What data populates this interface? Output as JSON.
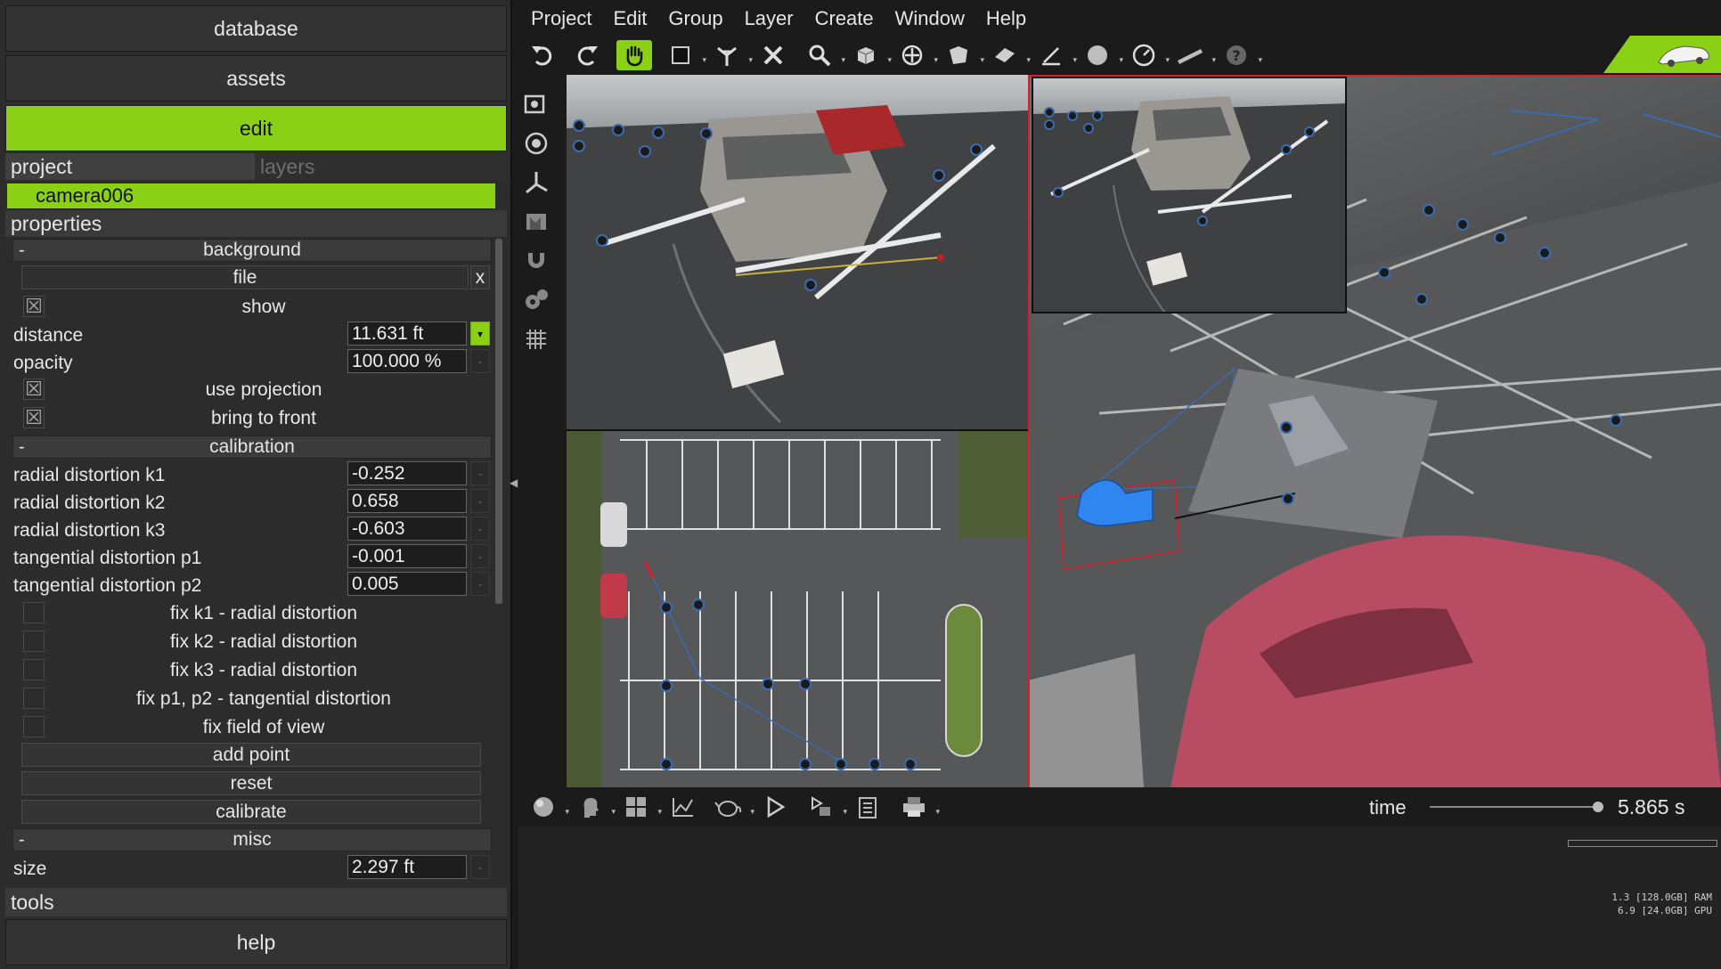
{
  "nav": {
    "database": "database",
    "assets": "assets",
    "edit": "edit",
    "tools": "tools",
    "help": "help"
  },
  "tabs": {
    "project": "project",
    "layers": "layers"
  },
  "selected_object": "camera006",
  "properties_label": "properties",
  "background": {
    "header": "background",
    "collapse": "-",
    "file_label": "file",
    "file_clear": "x",
    "show_label": "show",
    "distance_label": "distance",
    "distance_value": "11.631 ft",
    "opacity_label": "opacity",
    "opacity_value": "100.000 %",
    "use_projection_label": "use projection",
    "bring_to_front_label": "bring to front",
    "checked_mark": "☒"
  },
  "calibration": {
    "header": "calibration",
    "collapse": "-",
    "fields": [
      {
        "label": "radial distortion k1",
        "value": "-0.252"
      },
      {
        "label": "radial distortion k2",
        "value": "0.658"
      },
      {
        "label": "radial distortion k3",
        "value": "-0.603"
      },
      {
        "label": "tangential distortion p1",
        "value": "-0.001"
      },
      {
        "label": "tangential distortion p2",
        "value": "0.005"
      }
    ],
    "fixes": [
      "fix k1 - radial distortion",
      "fix k2 - radial distortion",
      "fix k3 - radial distortion",
      "fix p1, p2 - tangential distortion",
      "fix field of view"
    ],
    "buttons": {
      "add_point": "add point",
      "reset": "reset",
      "calibrate": "calibrate"
    }
  },
  "misc": {
    "header": "misc",
    "collapse": "-",
    "size_label": "size",
    "size_value": "2.297 ft"
  },
  "menus": [
    "Project",
    "Edit",
    "Group",
    "Layer",
    "Create",
    "Window",
    "Help"
  ],
  "colors": {
    "accent": "#8ad116",
    "panel": "#2c2c2c",
    "field": "#1d1d1d",
    "selection": "#d81f2a",
    "camera": "#2f86f0"
  },
  "icons": {
    "toolbar": [
      "undo-icon",
      "redo-icon",
      "hand-pan-icon",
      "select-box-icon",
      "pin-tool-icon",
      "delete-icon",
      "zoom-icon",
      "cube-icon",
      "move-gizmo-icon",
      "polygon-icon",
      "plane-icon",
      "measure-icon",
      "sphere-icon",
      "gauge-icon",
      "ruler-icon",
      "help-icon"
    ],
    "vertical": [
      "camera-icon",
      "target-icon",
      "axes-icon",
      "film-icon",
      "magnet-icon",
      "gear-cog-icon",
      "grid-icon"
    ],
    "bottom": [
      "sphere-shading-icon",
      "head-icon",
      "layout-icon",
      "graph-icon",
      "teapot-icon",
      "play-icon",
      "record-icon",
      "clipboard-icon",
      "print-icon"
    ]
  },
  "timeline": {
    "label": "time",
    "value": "5.865 s",
    "position": 1.0
  },
  "memory": {
    "ram": "1.3 [128.0GB] RAM",
    "gpu": "6.9 [24.0GB] GPU"
  }
}
